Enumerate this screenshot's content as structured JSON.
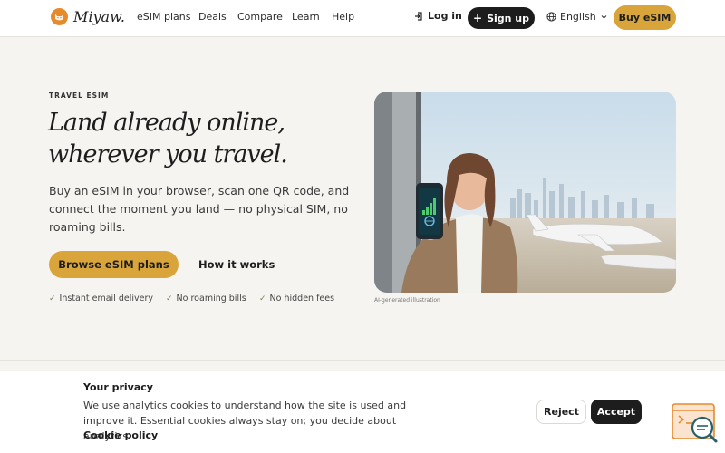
{
  "brand": {
    "name": "Miyaw.",
    "accent": "#d9a53b",
    "logo_color": "#e68a2e"
  },
  "nav": {
    "items": [
      "eSIM plans",
      "Deals",
      "Compare",
      "Learn",
      "Help"
    ]
  },
  "header": {
    "login_label": "Log in",
    "login_icon": "login-arrow-icon",
    "signup_label": "Sign up",
    "signup_icon": "plus-icon",
    "language": "English",
    "language_icon": "globe-icon",
    "buy_label": "Buy eSIM"
  },
  "hero": {
    "eyebrow": "TRAVEL ESIM",
    "title_line1": "Land already online,",
    "title_line2": "wherever you travel.",
    "subtitle": "Buy an eSIM in your browser, scan one QR code, and connect the moment you land — no physical SIM, no roaming bills.",
    "cta_label": "Browse eSIM plans",
    "secondary_label": "How it works",
    "features": [
      "Instant email delivery",
      "No roaming bills",
      "No hidden fees"
    ],
    "image_caption": "AI-generated illustration"
  },
  "cookie": {
    "title": "Your privacy",
    "text": "We use analytics cookies to understand how the site is used and improve it. Essential cookies always stay on; you decide about analytics.",
    "policy_label": "Cookie policy",
    "reject_label": "Reject",
    "accept_label": "Accept"
  }
}
